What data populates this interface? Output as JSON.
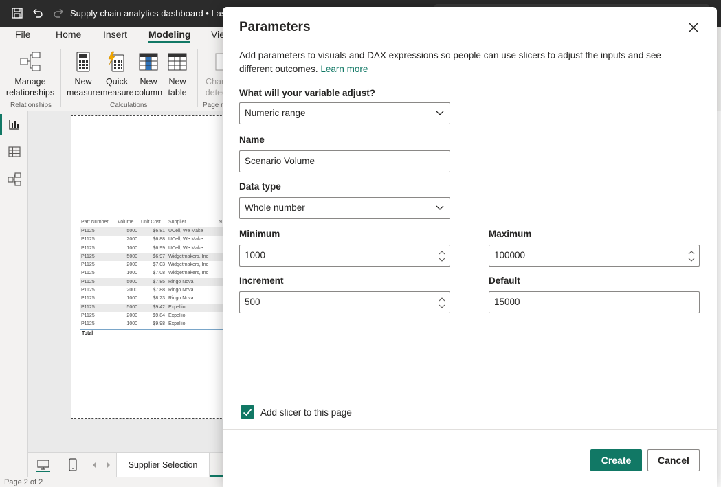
{
  "titlebar": {
    "title": "Supply chain analytics dashboard • Last sa"
  },
  "ribbon": {
    "tabs": [
      {
        "label": "File"
      },
      {
        "label": "Home"
      },
      {
        "label": "Insert"
      },
      {
        "label": "Modeling"
      },
      {
        "label": "Vie"
      }
    ],
    "buttons": {
      "manage_relationships": [
        "Manage",
        "relationships"
      ],
      "new_measure": [
        "New",
        "measure"
      ],
      "quick_measure": [
        "Quick",
        "measure"
      ],
      "new_column": [
        "New",
        "column"
      ],
      "new_table": [
        "New",
        "table"
      ],
      "change_detect": [
        "Chan",
        "detec"
      ]
    },
    "groups": {
      "relationships": "Relationships",
      "calculations": "Calculations",
      "page": "Page r"
    }
  },
  "report": {
    "table_headers": [
      "Part Number",
      "Volume",
      "Unit Cost",
      "Supplier",
      "N"
    ],
    "rows": [
      [
        "P1125",
        "5000",
        "$6.81",
        "UCell, We Make"
      ],
      [
        "P1125",
        "2000",
        "$6.88",
        "UCell, We Make"
      ],
      [
        "P1125",
        "1000",
        "$6.99",
        "UCell, We Make"
      ],
      [
        "P1125",
        "5000",
        "$6.97",
        "Widgetmakers, Inc"
      ],
      [
        "P1125",
        "2000",
        "$7.03",
        "Widgetmakers, Inc"
      ],
      [
        "P1125",
        "1000",
        "$7.08",
        "Widgetmakers, Inc"
      ],
      [
        "P1125",
        "5000",
        "$7.85",
        "Ringo Nova"
      ],
      [
        "P1125",
        "2000",
        "$7.88",
        "Ringo Nova"
      ],
      [
        "P1125",
        "1000",
        "$8.23",
        "Ringo Nova"
      ],
      [
        "P1125",
        "5000",
        "$9.42",
        "Expellio"
      ],
      [
        "P1125",
        "2000",
        "$9.84",
        "Expellio"
      ],
      [
        "P1125",
        "1000",
        "$9.98",
        "Expellio"
      ]
    ],
    "total_label": "Total"
  },
  "pagebar": {
    "tab_label": "Supplier Selection"
  },
  "status": {
    "page": "Page 2 of 2"
  },
  "dialog": {
    "title": "Parameters",
    "description": "Add parameters to visuals and DAX expressions so people can use slicers to adjust the inputs and see different outcomes.",
    "learn_more": "Learn more",
    "adjust_label": "What will your variable adjust?",
    "adjust_value": "Numeric range",
    "name_label": "Name",
    "name_value": "Scenario Volume",
    "datatype_label": "Data type",
    "datatype_value": "Whole number",
    "minimum_label": "Minimum",
    "minimum_value": "1000",
    "maximum_label": "Maximum",
    "maximum_value": "100000",
    "increment_label": "Increment",
    "increment_value": "500",
    "default_label": "Default",
    "default_value": "15000",
    "add_slicer_label": "Add slicer to this page",
    "add_slicer_checked": true,
    "create_label": "Create",
    "cancel_label": "Cancel"
  },
  "colors": {
    "accent": "#117865",
    "titlebar": "#2b2b2b",
    "ribbon": "#f3f2f1"
  },
  "icons": {
    "save": "save-icon",
    "undo": "undo-icon",
    "redo": "redo-icon",
    "close": "close-icon",
    "chevron": "chevron-down-icon",
    "check": "checkmark-icon"
  }
}
